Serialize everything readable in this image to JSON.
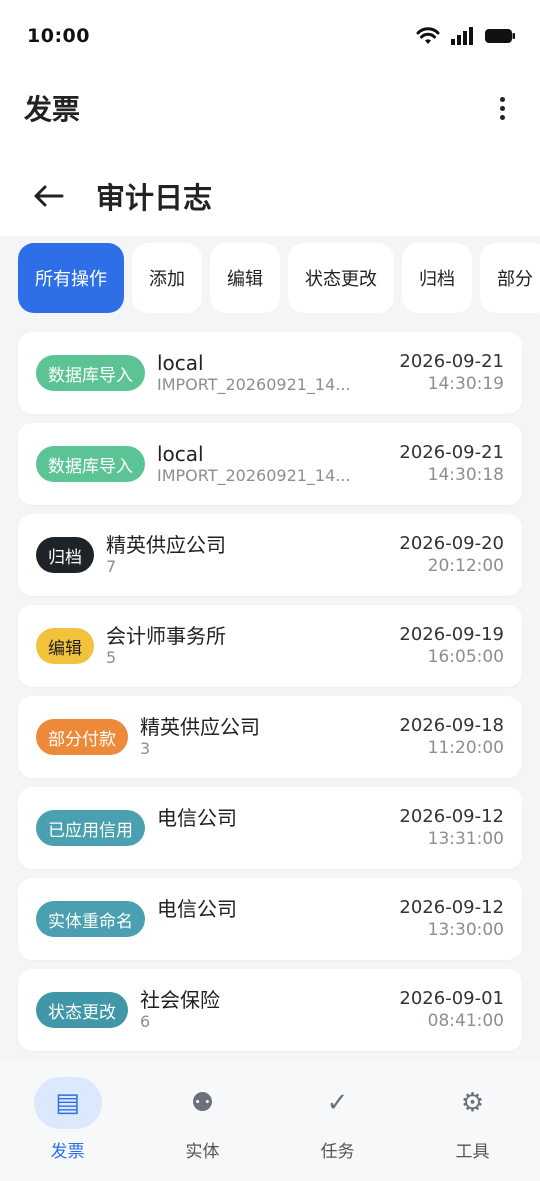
{
  "status_bar": {
    "time": "10:00"
  },
  "app_bar": {
    "title": "发票"
  },
  "header": {
    "title": "审计日志"
  },
  "filters": [
    {
      "label": "所有操作",
      "active": true
    },
    {
      "label": "添加",
      "active": false
    },
    {
      "label": "编辑",
      "active": false
    },
    {
      "label": "状态更改",
      "active": false
    },
    {
      "label": "归档",
      "active": false
    },
    {
      "label": "部分",
      "active": false
    }
  ],
  "logs": [
    {
      "badge": "数据库导入",
      "badge_color": "#5cc494",
      "title": "local",
      "sub": "IMPORT_20260921_14...",
      "date": "2026-09-21",
      "time": "14:30:19"
    },
    {
      "badge": "数据库导入",
      "badge_color": "#5cc494",
      "title": "local",
      "sub": "IMPORT_20260921_14...",
      "date": "2026-09-21",
      "time": "14:30:18"
    },
    {
      "badge": "归档",
      "badge_color": "#1e2328",
      "title": "精英供应公司",
      "sub": "7",
      "date": "2026-09-20",
      "time": "20:12:00"
    },
    {
      "badge": "编辑",
      "badge_color": "#f2c23c",
      "title": "会计师事务所",
      "sub": "5",
      "date": "2026-09-19",
      "time": "16:05:00"
    },
    {
      "badge": "部分付款",
      "badge_color": "#ec8a3a",
      "title": "精英供应公司",
      "sub": "3",
      "date": "2026-09-18",
      "time": "11:20:00"
    },
    {
      "badge": "已应用信用",
      "badge_color": "#4aa0b0",
      "title": "电信公司",
      "sub": "",
      "date": "2026-09-12",
      "time": "13:31:00"
    },
    {
      "badge": "实体重命名",
      "badge_color": "#4aa0b0",
      "title": "电信公司",
      "sub": "",
      "date": "2026-09-12",
      "time": "13:30:00"
    },
    {
      "badge": "状态更改",
      "badge_color": "#3f97a8",
      "title": "社会保险",
      "sub": "6",
      "date": "2026-09-01",
      "time": "08:41:00"
    }
  ],
  "bottom_nav": [
    {
      "label": "发票",
      "icon": "invoice-icon",
      "glyph": "▤",
      "active": true
    },
    {
      "label": "实体",
      "icon": "entity-icon",
      "glyph": "⚉",
      "active": false
    },
    {
      "label": "任务",
      "icon": "check-icon",
      "glyph": "✓",
      "active": false
    },
    {
      "label": "工具",
      "icon": "tools-icon",
      "glyph": "⚙",
      "active": false
    }
  ]
}
